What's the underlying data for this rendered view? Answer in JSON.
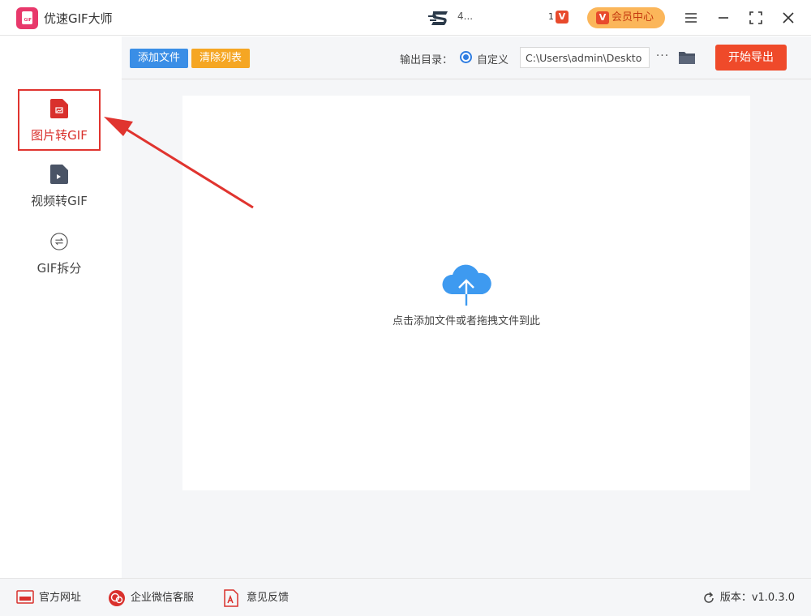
{
  "app": {
    "title": "优速GIF大师",
    "logo_text": "GIF"
  },
  "user": {
    "name": "4...",
    "vip_mini": "1"
  },
  "vip": {
    "label": "会员中心",
    "icon_text": "V"
  },
  "sidebar": {
    "items": [
      {
        "label": "图片转GIF",
        "icon": "image-file-icon",
        "active": true
      },
      {
        "label": "视频转GIF",
        "icon": "video-file-icon",
        "active": false
      },
      {
        "label": "GIF拆分",
        "icon": "split-icon",
        "active": false
      }
    ]
  },
  "toolbar": {
    "add_label": "添加文件",
    "clear_label": "清除列表",
    "output_label": "输出目录：",
    "radio_label": "自定义",
    "path_value": "C:\\Users\\admin\\Deskto",
    "more_label": "···",
    "export_label": "开始导出"
  },
  "dropzone": {
    "text": "点击添加文件或者拖拽文件到此"
  },
  "footer": {
    "website": "官方网址",
    "wechat": "企业微信客服",
    "feedback": "意见反馈",
    "version": "版本：v1.0.3.0"
  },
  "colors": {
    "accent_red": "#e0342f",
    "primary_blue": "#3a8ee6",
    "orange": "#f5a623",
    "export_red": "#ef4a2a",
    "vip_gold": "#fbb65a",
    "cloud_blue": "#3e9af0"
  }
}
